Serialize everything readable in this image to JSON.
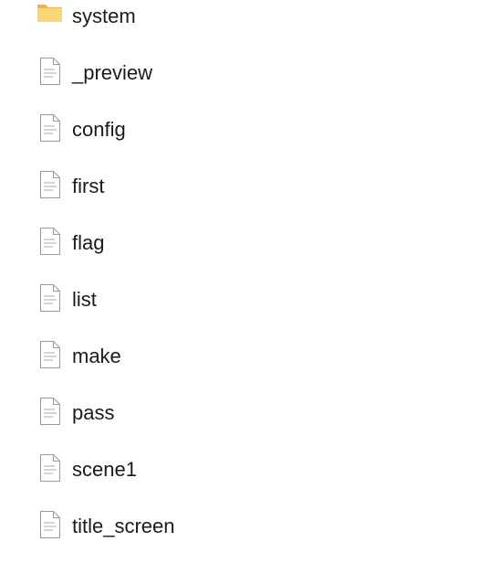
{
  "items": [
    {
      "name": "system",
      "type": "folder",
      "icon": "folder-icon"
    },
    {
      "name": "_preview",
      "type": "file",
      "icon": "document-icon"
    },
    {
      "name": "config",
      "type": "file",
      "icon": "document-icon"
    },
    {
      "name": "first",
      "type": "file",
      "icon": "document-icon"
    },
    {
      "name": "flag",
      "type": "file",
      "icon": "document-icon"
    },
    {
      "name": "list",
      "type": "file",
      "icon": "document-icon"
    },
    {
      "name": "make",
      "type": "file",
      "icon": "document-icon"
    },
    {
      "name": "pass",
      "type": "file",
      "icon": "document-icon"
    },
    {
      "name": "scene1",
      "type": "file",
      "icon": "document-icon"
    },
    {
      "name": "title_screen",
      "type": "file",
      "icon": "document-icon"
    }
  ],
  "colors": {
    "folder_body": "#f8d775",
    "folder_tab": "#e8b74a",
    "doc_outline": "#9a9a9a",
    "doc_lines": "#a8a8a8"
  }
}
